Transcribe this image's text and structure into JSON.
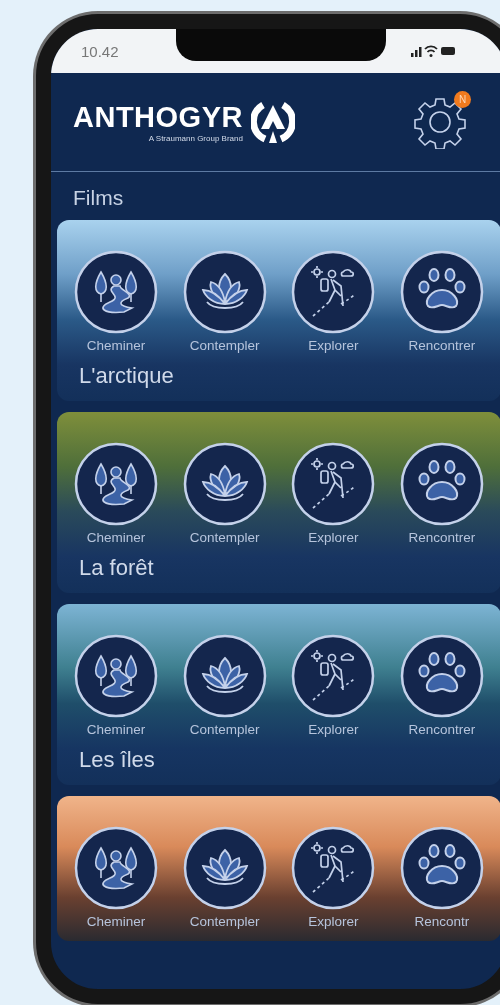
{
  "status_bar": {
    "time": "10.42"
  },
  "header": {
    "brand": "ANTHOGYR",
    "tagline": "A Straumann Group Brand",
    "settings_badge": "N"
  },
  "section_title": "Films",
  "films": [
    {
      "title": "L'arctique",
      "activities": [
        {
          "kind": "path",
          "label": "Cheminer"
        },
        {
          "kind": "lotus",
          "label": "Contempler"
        },
        {
          "kind": "hiker",
          "label": "Explorer"
        },
        {
          "kind": "paw",
          "label": "Rencontrer"
        }
      ]
    },
    {
      "title": "La forêt",
      "activities": [
        {
          "kind": "path",
          "label": "Cheminer"
        },
        {
          "kind": "lotus",
          "label": "Contempler"
        },
        {
          "kind": "hiker",
          "label": "Explorer"
        },
        {
          "kind": "paw",
          "label": "Rencontrer"
        }
      ]
    },
    {
      "title": "Les îles",
      "activities": [
        {
          "kind": "path",
          "label": "Cheminer"
        },
        {
          "kind": "lotus",
          "label": "Contempler"
        },
        {
          "kind": "hiker",
          "label": "Explorer"
        },
        {
          "kind": "paw",
          "label": "Rencontrer"
        }
      ]
    },
    {
      "activities": [
        {
          "kind": "path",
          "label": "Cheminer"
        },
        {
          "kind": "lotus",
          "label": "Contempler"
        },
        {
          "kind": "hiker",
          "label": "Explorer"
        },
        {
          "kind": "paw",
          "label": "Rencontr"
        }
      ]
    }
  ]
}
